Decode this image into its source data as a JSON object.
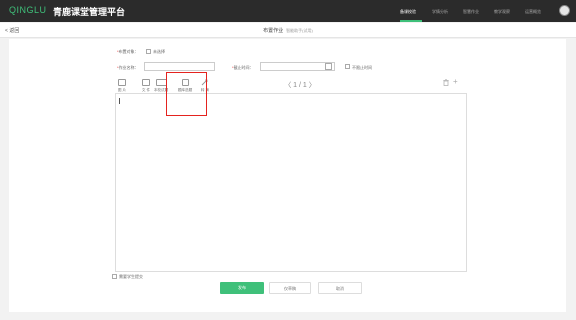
{
  "header": {
    "logo": "QINGLU",
    "brand": "青鹿课堂管理平台",
    "nav": [
      "备课校验",
      "学情分析",
      "智慧作业",
      "教学观察",
      "运营概览"
    ],
    "active_nav": 0
  },
  "subbar": {
    "back_label": "返回",
    "title": "布置作业",
    "subtitle": "智能助手(试用)"
  },
  "form": {
    "target_label": "布置对象：",
    "target_value": "未选择",
    "name_label": "作业名称：",
    "name_value": "",
    "deadline_label": "截止时间：",
    "deadline_value": "",
    "no_deadline_label": "不限止时间"
  },
  "toolbar": {
    "tools": [
      {
        "label": "图 片",
        "icon": "image-icon"
      },
      {
        "label": "文 件",
        "icon": "file-icon"
      },
      {
        "label": "本校试题",
        "icon": "book-icon"
      },
      {
        "label": "题库选题",
        "icon": "question-bank-icon"
      },
      {
        "label": "转 换",
        "icon": "convert-icon"
      }
    ],
    "pager": "〈  1 / 1  〉",
    "delete_icon": "trash-icon",
    "add_icon": "plus-icon"
  },
  "footer": {
    "save_draft_label": "需要学生提交",
    "publish_label": "发布",
    "save_label": "仅草稿",
    "cancel_label": "取消"
  },
  "colors": {
    "brand_green": "#3fc07a",
    "topbar": "#2b2b2b",
    "highlight_red": "#e4231f"
  }
}
